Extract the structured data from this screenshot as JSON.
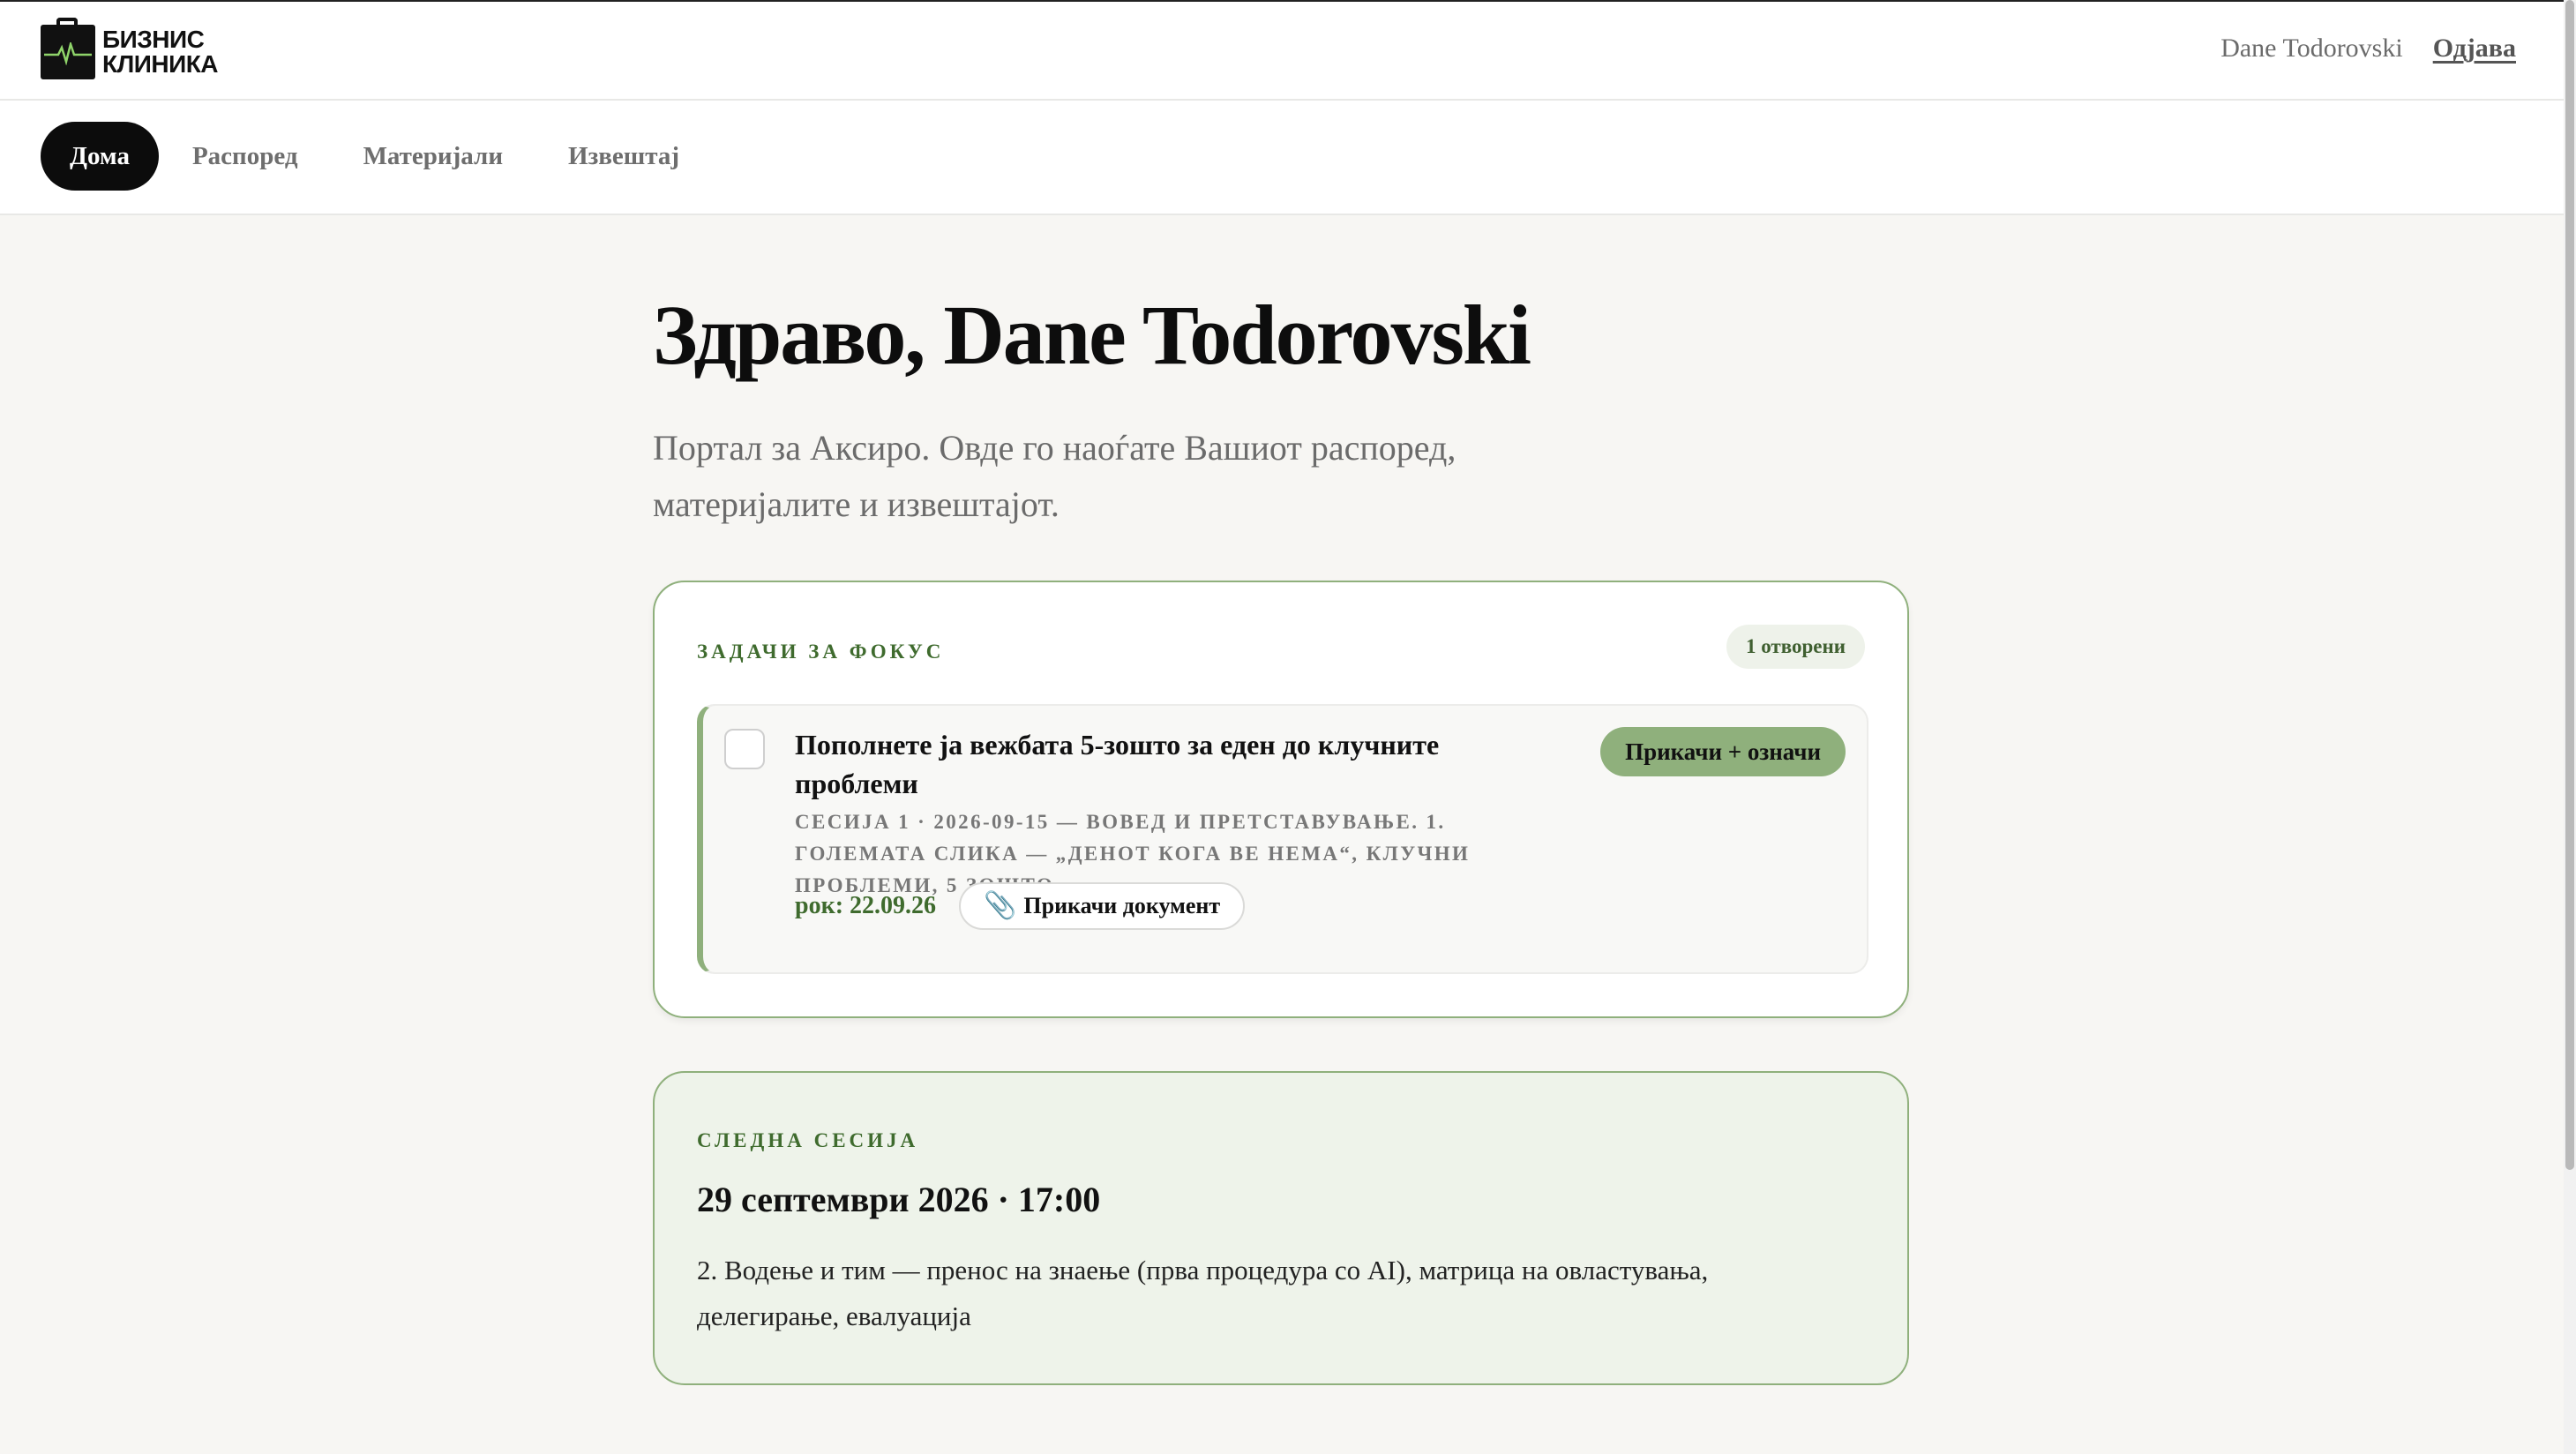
{
  "brand": {
    "line1": "БИЗНИС",
    "line2": "КЛИНИКА",
    "logo_icon": "briefcase-heartbeat-icon"
  },
  "header": {
    "user_name": "Dane Todorovski",
    "logout_label": "Одјава"
  },
  "nav": {
    "items": [
      {
        "label": "Дома",
        "active": true
      },
      {
        "label": "Распоред",
        "active": false
      },
      {
        "label": "Материјали",
        "active": false
      },
      {
        "label": "Извештај",
        "active": false
      }
    ]
  },
  "main": {
    "greeting": "Здраво, Dane Todorovski",
    "intro": "Портал за Аксиро. Овде го наоѓате Вашиот распоред, материјалите и извештајот."
  },
  "focus": {
    "label": "ЗАДАЧИ ЗА ФОКУС",
    "open_count": "1 отворени",
    "task": {
      "title": "Пополнете ја вежбата 5-зошто за еден до клучните проблеми",
      "meta": "СЕСИЈА 1 · 2026-09-15 — ВОВЕД И ПРЕТСТАВУВАЊЕ. 1. ГОЛЕМАТА СЛИКА — „ДЕНОТ КОГА ВЕ НЕМА“, КЛУЧНИ ПРОБЛЕМИ, 5 ЗОШТО",
      "due": "рок: 22.09.26",
      "attach_doc_label": "Прикачи документ",
      "attach_icon": "paperclip-icon",
      "attach_mark_label": "Прикачи + означи"
    }
  },
  "next_session": {
    "label": "СЛЕДНА СЕСИЈА",
    "date": "29 септември 2026 · 17:00",
    "description": "2. Водење и тим — пренос на знаење (прва процедура со AI), матрица на овластувања, делегирање, евалуација"
  },
  "colors": {
    "accent": "#8fb07c",
    "accent_dark": "#3f6b2e",
    "accent_soft": "#eef3ea",
    "nav_active": "#0c0c0c"
  }
}
